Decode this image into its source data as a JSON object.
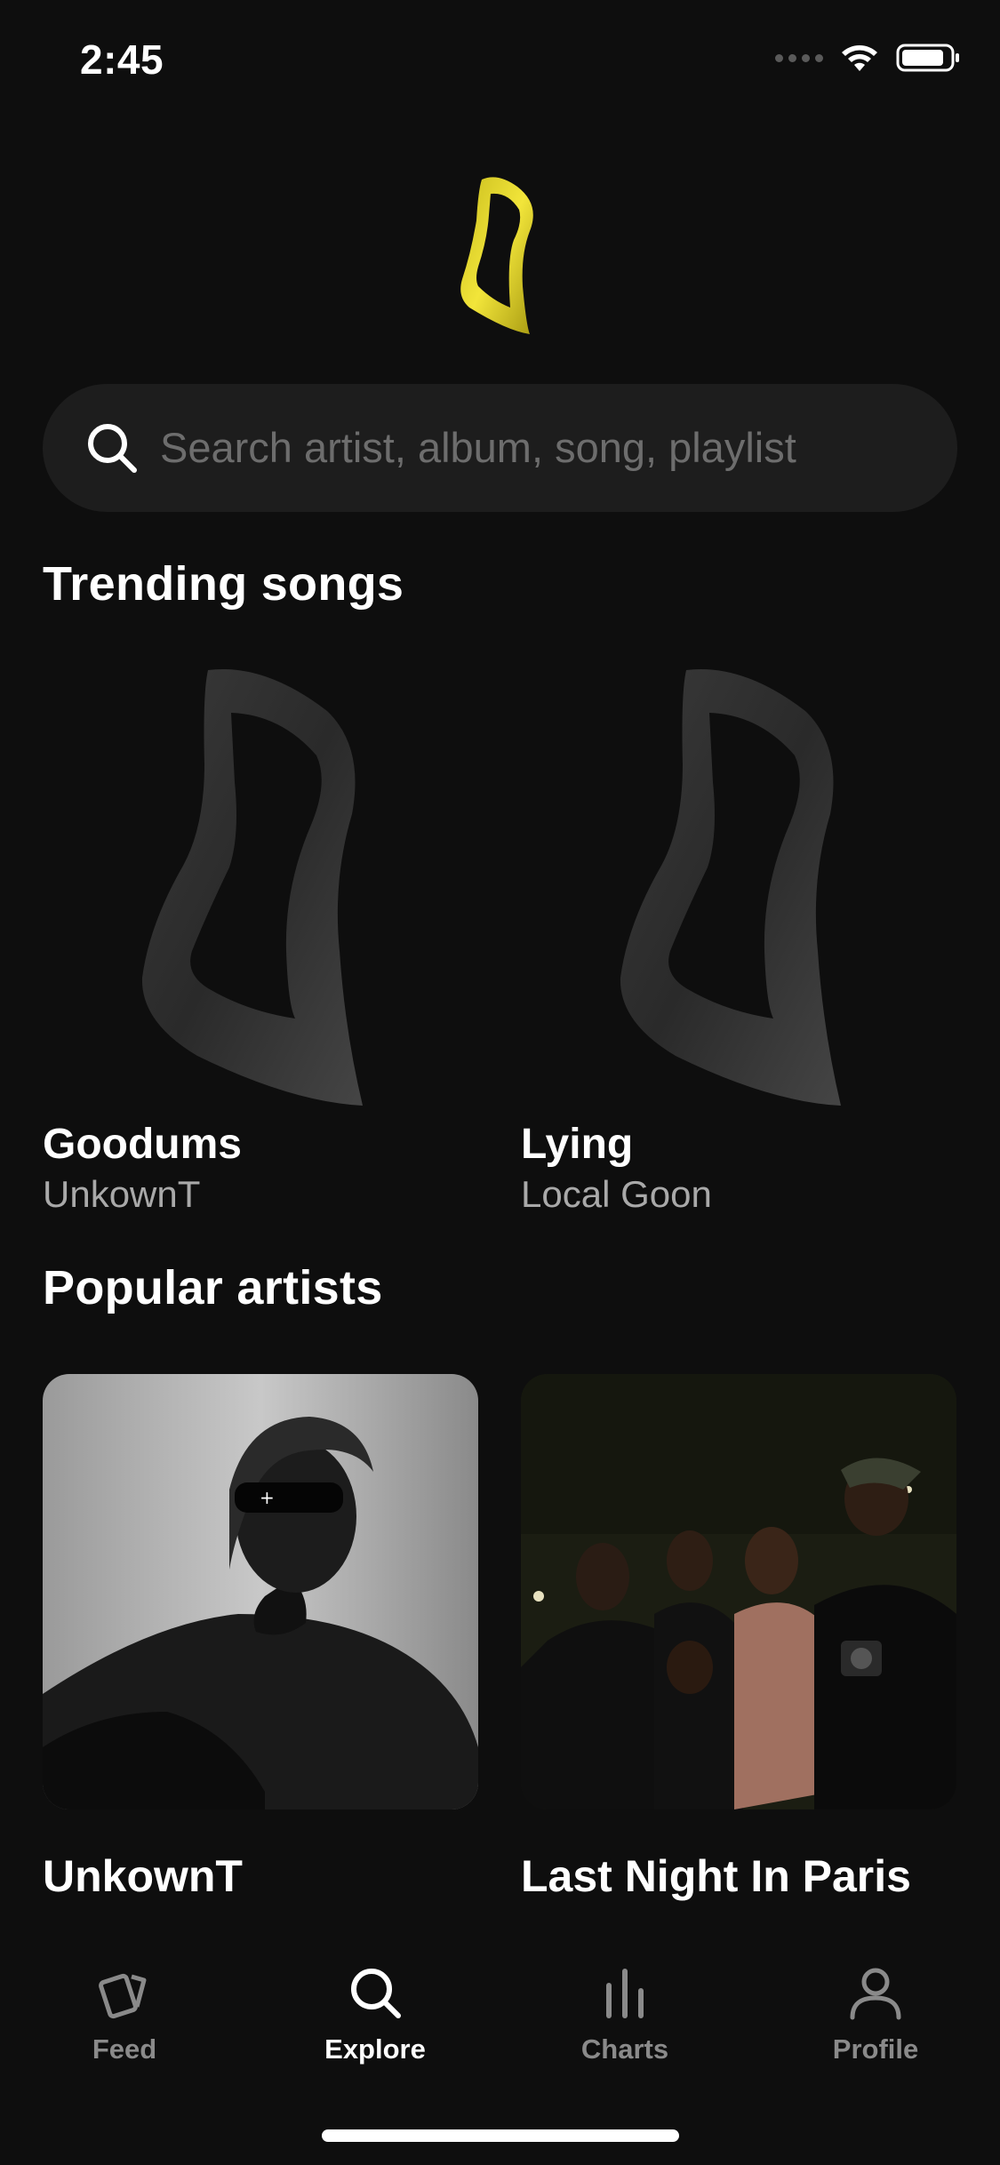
{
  "status": {
    "time": "2:45"
  },
  "search": {
    "placeholder": "Search artist, album, song, playlist"
  },
  "trending": {
    "title": "Trending songs",
    "songs": [
      {
        "title": "Goodums",
        "artist": "UnkownT"
      },
      {
        "title": "Lying",
        "artist": "Local Goon"
      }
    ]
  },
  "popular": {
    "title": "Popular artists",
    "artists": [
      {
        "name": "UnkownT"
      },
      {
        "name": "Last Night In Paris"
      }
    ]
  },
  "tabs": [
    {
      "label": "Feed",
      "icon": "feed-icon",
      "active": false
    },
    {
      "label": "Explore",
      "icon": "search-icon",
      "active": true
    },
    {
      "label": "Charts",
      "icon": "charts-icon",
      "active": false
    },
    {
      "label": "Profile",
      "icon": "profile-icon",
      "active": false
    }
  ],
  "colors": {
    "background": "#0e0e0e",
    "accent": "#e6d82a",
    "search_bg": "#1d1d1d"
  }
}
